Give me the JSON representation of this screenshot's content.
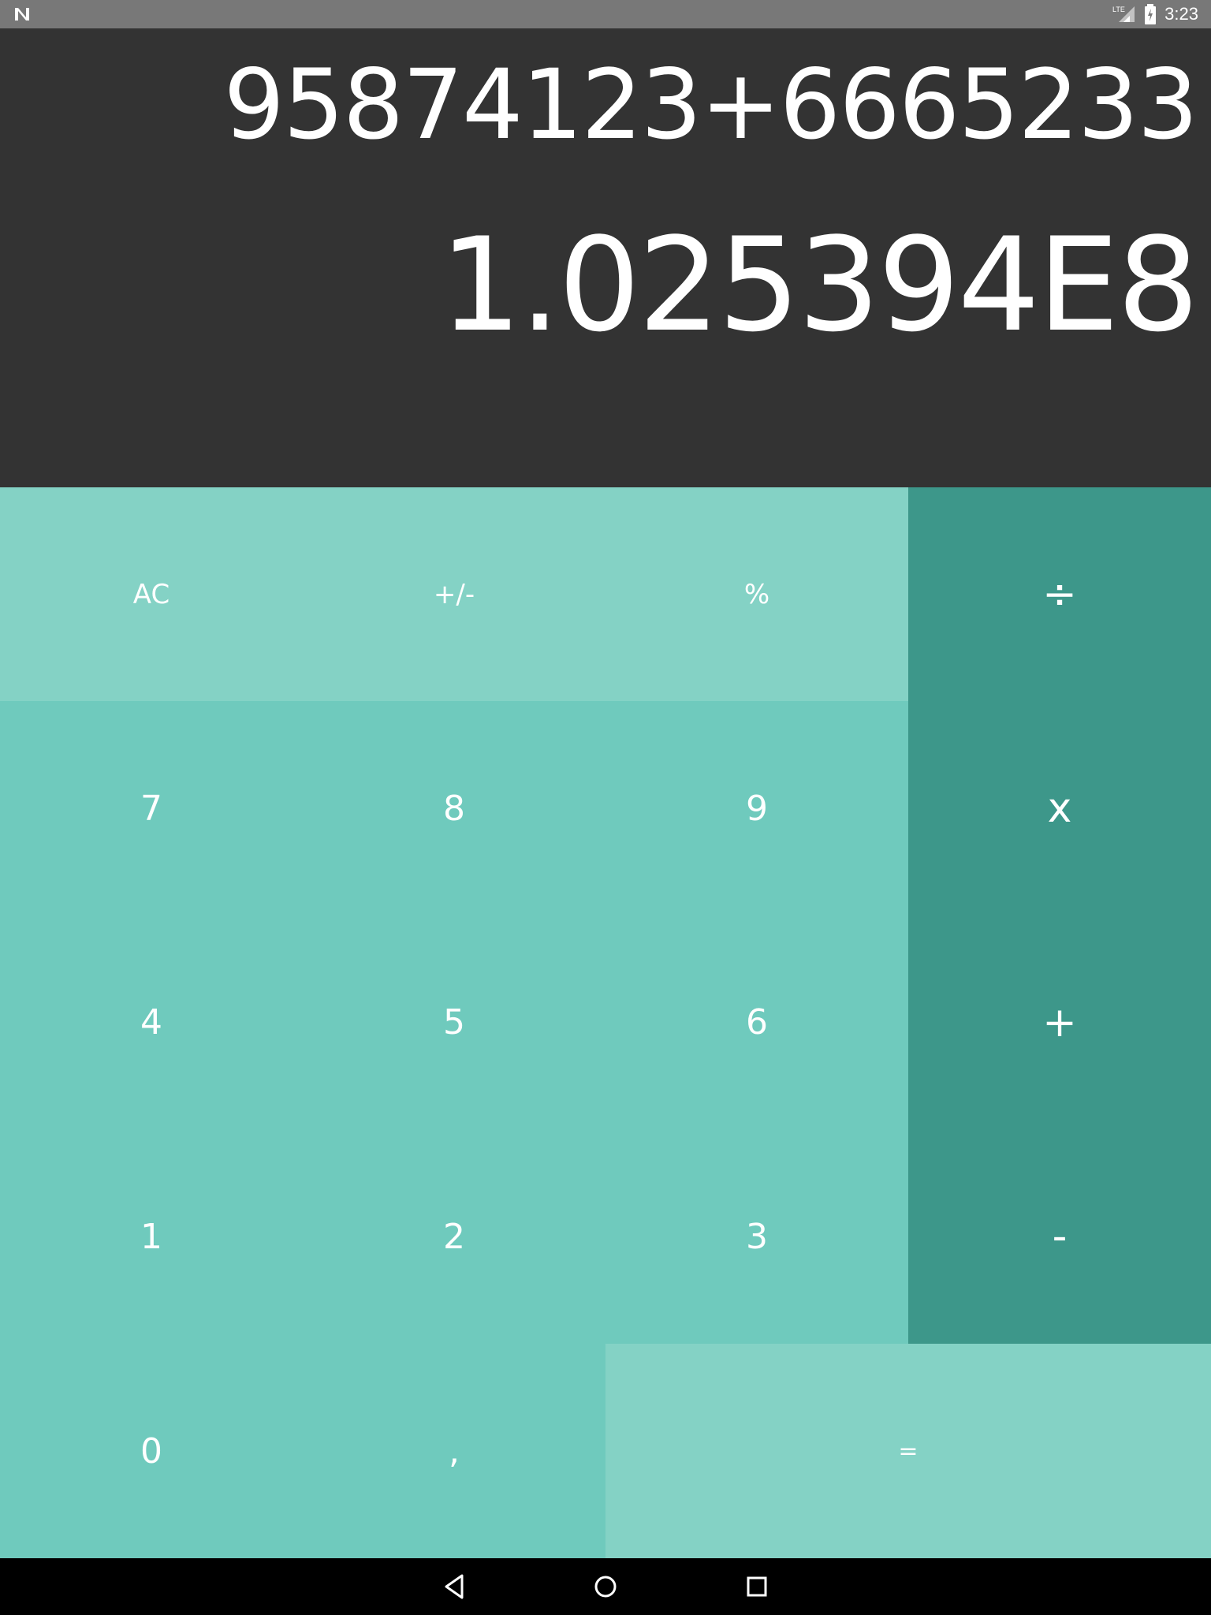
{
  "status_bar": {
    "time": "3:23",
    "network": "LTE",
    "icons": [
      "notification-n-icon",
      "signal-icon",
      "battery-icon"
    ]
  },
  "display": {
    "expression": "95874123+6665233",
    "result": "1.025394E8"
  },
  "keypad": {
    "row1": [
      "AC",
      "+/-",
      "%"
    ],
    "row2": [
      "7",
      "8",
      "9"
    ],
    "row3": [
      "4",
      "5",
      "6"
    ],
    "row4": [
      "1",
      "2",
      "3"
    ],
    "row5": [
      "0",
      ","
    ],
    "operators": {
      "divide": "÷",
      "multiply": "x",
      "add": "+",
      "subtract": "-"
    },
    "equals": "="
  },
  "nav_bar": {
    "icons": [
      "back-icon",
      "home-icon",
      "recents-icon"
    ]
  },
  "colors": {
    "display_bg": "#333333",
    "function_keys": "#84d2c5",
    "number_keys": "#6fcabd",
    "operator_keys": "#3d978a",
    "status_bar": "#787878",
    "nav_bar": "#000000"
  }
}
